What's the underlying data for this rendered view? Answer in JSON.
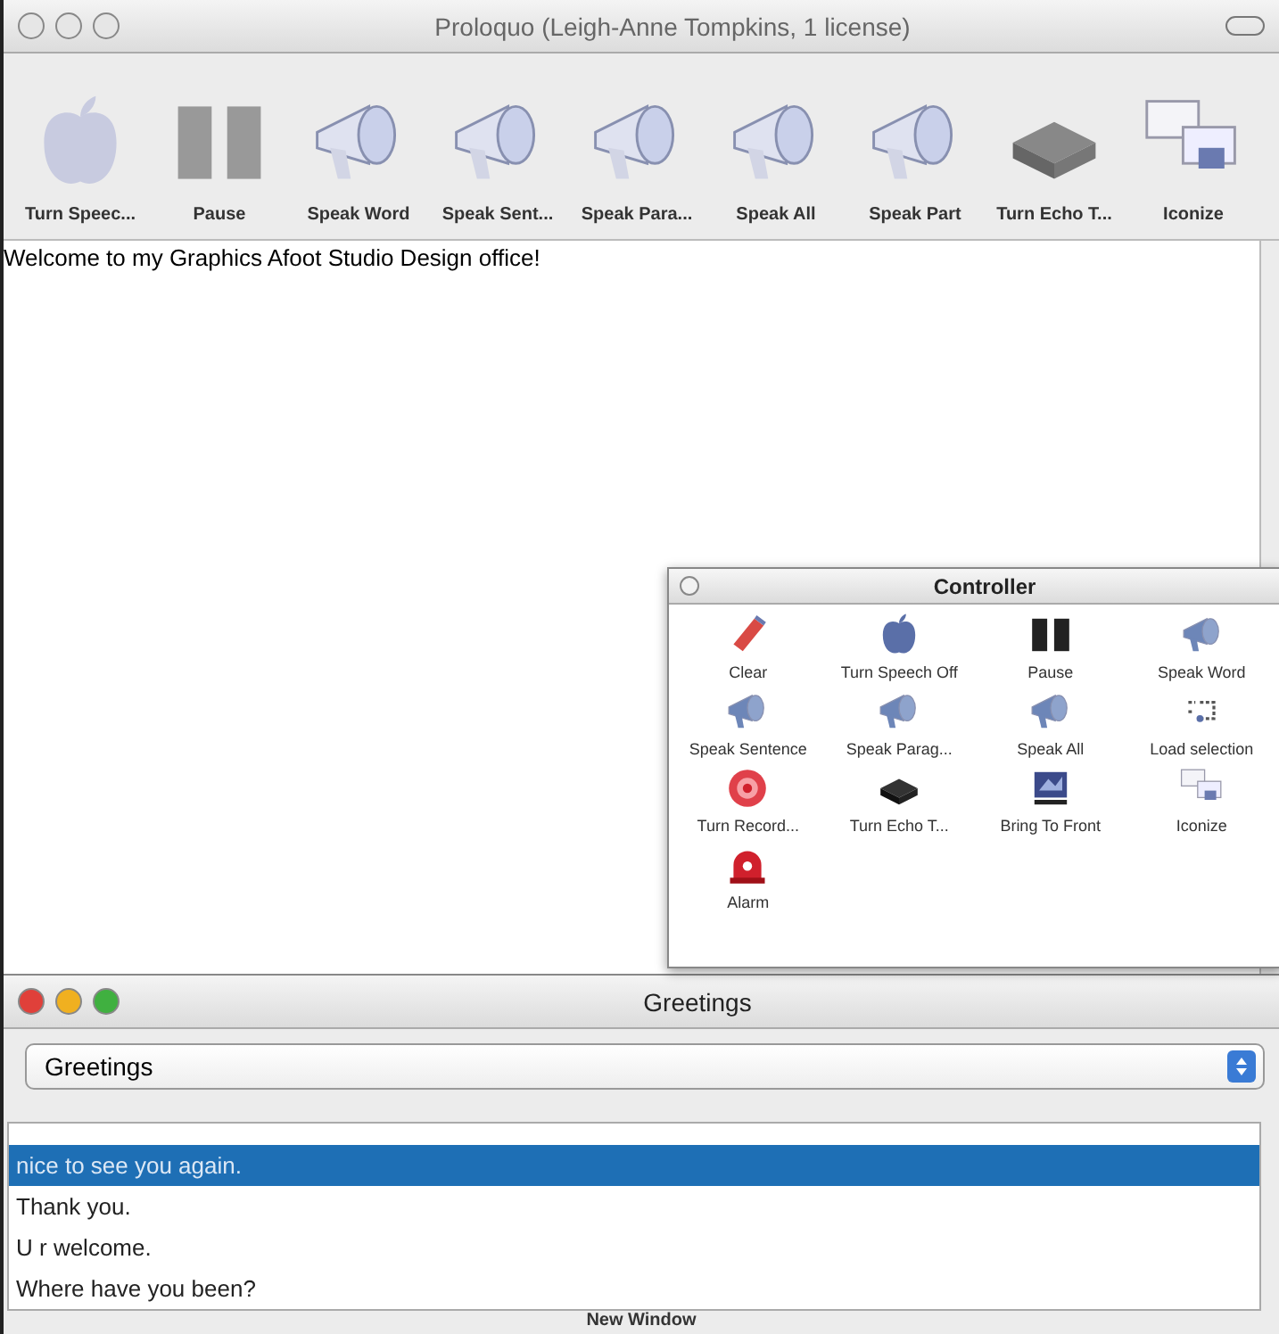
{
  "main_window": {
    "title": "Proloquo (Leigh-Anne Tompkins, 1 license)",
    "toolbar": [
      {
        "kind": "apple",
        "label": "Turn Speec..."
      },
      {
        "kind": "pause",
        "label": "Pause"
      },
      {
        "kind": "megaphone",
        "label": "Speak Word"
      },
      {
        "kind": "megaphone",
        "label": "Speak Sent..."
      },
      {
        "kind": "megaphone",
        "label": "Speak Para..."
      },
      {
        "kind": "megaphone",
        "label": "Speak All"
      },
      {
        "kind": "megaphone",
        "label": "Speak Part"
      },
      {
        "kind": "device",
        "label": "Turn Echo T..."
      },
      {
        "kind": "windows",
        "label": "Iconize"
      }
    ],
    "text": "Welcome to my Graphics Afoot Studio Design office!"
  },
  "controller": {
    "title": "Controller",
    "items": [
      {
        "kind": "eraser",
        "label": "Clear"
      },
      {
        "kind": "apple",
        "label": "Turn Speech Off"
      },
      {
        "kind": "pause",
        "label": "Pause"
      },
      {
        "kind": "megaphone",
        "label": "Speak Word"
      },
      {
        "kind": "megaphone",
        "label": "Speak Sentence"
      },
      {
        "kind": "megaphone",
        "label": "Speak Parag..."
      },
      {
        "kind": "megaphone",
        "label": "Speak All"
      },
      {
        "kind": "load",
        "label": "Load selection"
      },
      {
        "kind": "record",
        "label": "Turn Record..."
      },
      {
        "kind": "device",
        "label": "Turn Echo T..."
      },
      {
        "kind": "front",
        "label": "Bring To Front"
      },
      {
        "kind": "windows",
        "label": "Iconize"
      },
      {
        "kind": "alarm",
        "label": "Alarm"
      }
    ]
  },
  "greetings": {
    "title": "Greetings",
    "category": "Greetings",
    "phrases": [
      {
        "text": "nice to see you again.",
        "selected": true
      },
      {
        "text": "Thank you.",
        "selected": false
      },
      {
        "text": "U r welcome.",
        "selected": false
      },
      {
        "text": "Where have you been?",
        "selected": false
      }
    ],
    "footer": "New Window"
  }
}
